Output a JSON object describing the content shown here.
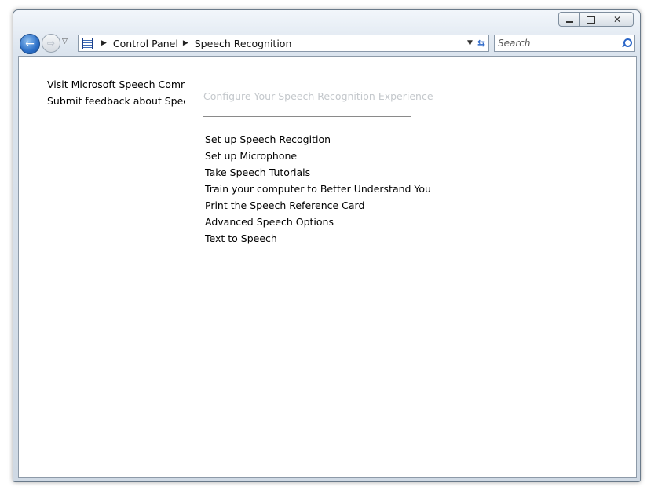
{
  "caption": {
    "minimize_glyph": "",
    "maximize_glyph": "",
    "close_glyph": "✕"
  },
  "nav": {
    "back_glyph": "←",
    "forward_glyph": "⇨",
    "history_glyph": "▽"
  },
  "address": {
    "breadcrumbs": [
      "Control Panel",
      "Speech Recognition"
    ],
    "separator": "▶",
    "dropdown_glyph": "▼",
    "refresh_glyph": "⇆"
  },
  "search": {
    "placeholder": "Search"
  },
  "sidebar": {
    "links": [
      "Visit Microsoft Speech Community",
      "Submit feedback about Speech Recognition"
    ]
  },
  "main": {
    "heading": "Configure Your Speech Recognition Experience",
    "tasks": [
      "Set up Speech Recogition",
      "Set up Microphone",
      "Take Speech Tutorials",
      "Train your computer to Better Understand You",
      "Print the Speech Reference Card",
      "Advanced Speech Options",
      "Text to Speech"
    ]
  },
  "colors": {
    "accent": "#2a66c8",
    "heading_disabled": "#c4c8cc"
  }
}
